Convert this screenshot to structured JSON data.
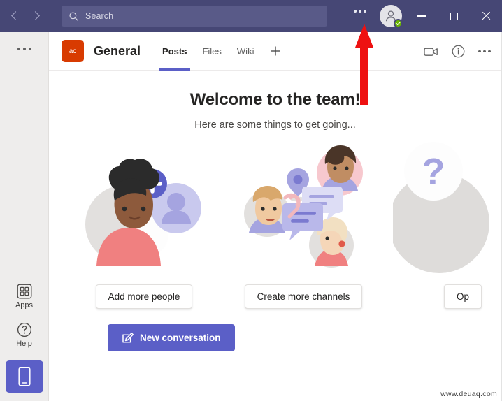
{
  "titlebar": {
    "back_icon": "chevron-left-icon",
    "forward_icon": "chevron-right-icon",
    "search": {
      "placeholder": "Search",
      "value": "",
      "icon": "search-icon"
    },
    "more_icon": "ellipsis-icon",
    "avatar": {
      "icon": "person-avatar-icon",
      "presence": "available",
      "presence_color": "#6bb700"
    },
    "window": {
      "minimize": "minimize-icon",
      "maximize": "maximize-icon",
      "close": "close-icon"
    },
    "background_color": "#464775"
  },
  "rail": {
    "more_icon": "ellipsis-icon",
    "items": [
      {
        "label": "Apps",
        "icon": "apps-grid-icon"
      },
      {
        "label": "Help",
        "icon": "help-question-icon"
      }
    ],
    "mobile_button": {
      "icon": "mobile-phone-icon",
      "color": "#5b5fc7"
    }
  },
  "channel": {
    "team_initials": "ac",
    "team_avatar_color": "#d83b01",
    "name": "General",
    "tabs": [
      {
        "label": "Posts",
        "active": true
      },
      {
        "label": "Files",
        "active": false
      },
      {
        "label": "Wiki",
        "active": false
      }
    ],
    "add_tab_icon": "plus-icon",
    "actions": [
      {
        "icon": "video-camera-icon"
      },
      {
        "icon": "info-circle-icon"
      },
      {
        "icon": "ellipsis-icon"
      }
    ],
    "active_tab_color": "#5b5fc7"
  },
  "welcome": {
    "heading": "Welcome to the team!",
    "subheading": "Here are some things to get going..."
  },
  "cards": [
    {
      "button_label": "Add more people",
      "art": "add-people-illustration"
    },
    {
      "button_label": "Create more channels",
      "art": "channels-chat-illustration"
    },
    {
      "button_label": "Op",
      "art": "faq-question-illustration"
    }
  ],
  "compose": {
    "new_conversation_label": "New conversation",
    "icon": "compose-pencil-icon",
    "color": "#5b5fc7"
  },
  "annotation": {
    "arrow_color": "#ee1111",
    "points_to": "titlebar-more-ellipsis"
  },
  "watermark": {
    "text": "www.deuaq.com"
  }
}
